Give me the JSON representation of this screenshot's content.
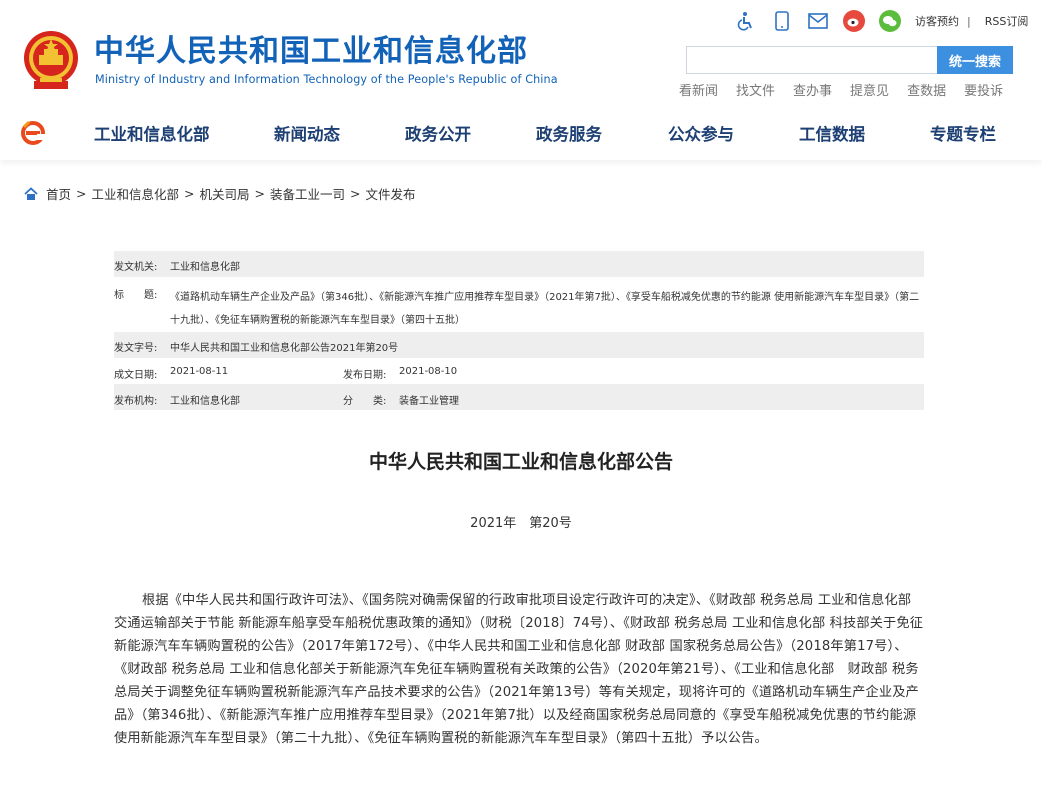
{
  "site": {
    "title_cn": "中华人民共和国工业和信息化部",
    "title_en": "Ministry of Industry and Information Technology of the People's Republic of China"
  },
  "top_bar": {
    "icons": [
      "accessibility-icon",
      "mobile-icon",
      "mail-icon",
      "weibo-icon",
      "wechat-icon"
    ],
    "visitor_login": "访客预约",
    "separator": "|",
    "rss": "RSS订阅"
  },
  "search": {
    "placeholder": "",
    "button": "统一搜索"
  },
  "quick_links": [
    "看新闻",
    "找文件",
    "查办事",
    "提意见",
    "查数据",
    "要投诉"
  ],
  "nav": [
    "工业和信息化部",
    "新闻动态",
    "政务公开",
    "政务服务",
    "公众参与",
    "工信数据",
    "专题专栏"
  ],
  "breadcrumb": [
    "首页",
    "工业和信息化部",
    "机关司局",
    "装备工业一司",
    "文件发布"
  ],
  "info": {
    "issuer_label": "发文机关:",
    "issuer": "工业和信息化部",
    "title_label": "标　　题:",
    "title": "《道路机动车辆生产企业及产品》（第346批）、《新能源汽车推广应用推荐车型目录》（2021年第7批）、《享受车船税减免优惠的节约能源 使用新能源汽车车型目录》（第二十九批）、《免征车辆购置税的新能源汽车车型目录》（第四十五批）",
    "docno_label": "发文字号:",
    "docno": "中华人民共和国工业和信息化部公告2021年第20号",
    "created_label": "成文日期:",
    "created": "2021-08-11",
    "published_label": "发布日期:",
    "published": "2021-08-10",
    "org_label": "发布机构:",
    "org": "工业和信息化部",
    "category_label": "分　　类:",
    "category": "装备工业管理"
  },
  "document": {
    "title": "中华人民共和国工业和信息化部公告",
    "number": "2021年　第20号",
    "body": "根据《中华人民共和国行政许可法》、《国务院对确需保留的行政审批项目设定行政许可的决定》、《财政部 税务总局 工业和信息化部 交通运输部关于节能 新能源车船享受车船税优惠政策的通知》（财税〔2018〕74号）、《财政部 税务总局 工业和信息化部 科技部关于免征新能源汽车车辆购置税的公告》（2017年第172号）、《中华人民共和国工业和信息化部 财政部 国家税务总局公告》（2018年第17号）、《财政部 税务总局 工业和信息化部关于新能源汽车免征车辆购置税有关政策的公告》（2020年第21号）、《工业和信息化部　财政部 税务总局关于调整免征车辆购置税新能源汽车产品技术要求的公告》（2021年第13号）等有关规定，现将许可的《道路机动车辆生产企业及产品》（第346批）、《新能源汽车推广应用推荐车型目录》（2021年第7批）以及经商国家税务总局同意的《享受车船税减免优惠的节约能源 使用新能源汽车车型目录》（第二十九批）、《免征车辆购置税的新能源汽车车型目录》（第四十五批）予以公告。"
  }
}
